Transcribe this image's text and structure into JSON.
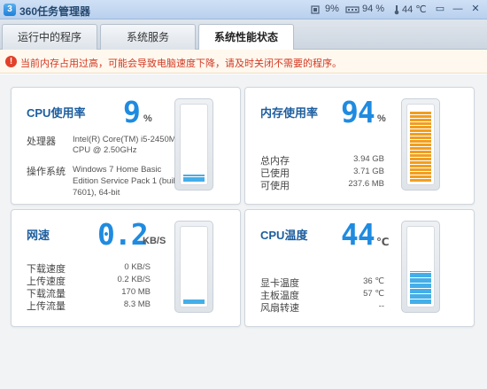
{
  "titlebar": {
    "app_title": "360任务管理器",
    "cpu_stat": "9%",
    "mem_stat": "94 %",
    "temp_stat": "44 ℃",
    "icon_names": [
      "cpu-icon",
      "memory-icon",
      "thermometer-icon",
      "window-icon",
      "minimize-icon",
      "close-icon"
    ]
  },
  "tabs": [
    {
      "label": "运行中的程序",
      "active": false
    },
    {
      "label": "系统服务",
      "active": false
    },
    {
      "label": "系统性能状态",
      "active": true
    }
  ],
  "warning": {
    "icon": "!",
    "text": "当前内存占用过高，可能会导致电脑速度下降，请及时关闭不需要的程序。"
  },
  "cpu": {
    "title": "CPU使用率",
    "value": "9",
    "unit": "%",
    "usage_fraction": 0.09,
    "processor_label": "处理器",
    "processor_value_1": "Intel(R) Core(TM) i5-2450M",
    "processor_value_2": "CPU @ 2.50GHz",
    "os_label": "操作系统",
    "os_value_1": "Windows 7 Home Basic",
    "os_value_2": "Edition Service Pack 1 (build",
    "os_value_3": "7601), 64-bit"
  },
  "memory": {
    "title": "内存使用率",
    "value": "94",
    "unit": "%",
    "usage_fraction": 0.94,
    "rows": [
      {
        "label": "总内存",
        "value": "3.94 GB"
      },
      {
        "label": "已使用",
        "value": "3.71 GB"
      },
      {
        "label": "可使用",
        "value": "237.6 MB"
      }
    ]
  },
  "network": {
    "title": "网速",
    "value": "0.2",
    "unit": "KB/S",
    "usage_fraction": 0.02,
    "rows": [
      {
        "label": "下载速度",
        "value": "0 KB/S"
      },
      {
        "label": "上传速度",
        "value": "0.2 KB/S"
      },
      {
        "label": "下载流量",
        "value": "170 MB"
      },
      {
        "label": "上传流量",
        "value": "8.3 MB"
      }
    ]
  },
  "temperature": {
    "title": "CPU温度",
    "value": "44",
    "unit": "℃",
    "usage_fraction": 0.44,
    "rows": [
      {
        "label": "显卡温度",
        "value": "36 ℃"
      },
      {
        "label": "主板温度",
        "value": "57 ℃"
      },
      {
        "label": "风扇转速",
        "value": "--"
      }
    ]
  },
  "colors": {
    "accent_blue": "#1f8be0",
    "title_blue": "#1c5d9e",
    "warning_red": "#d23a24",
    "memory_orange": "#f29e1f",
    "gauge_blue": "#45aee8"
  }
}
